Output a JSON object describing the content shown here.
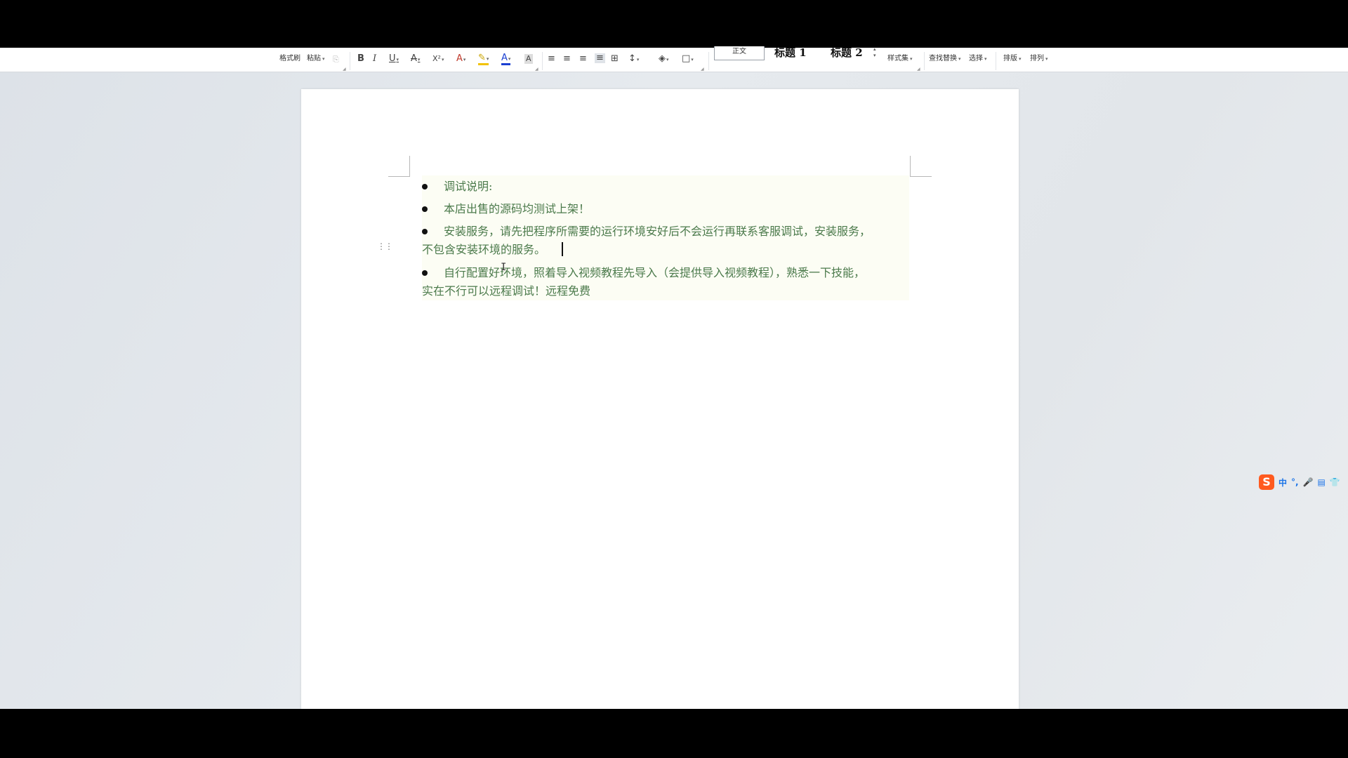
{
  "ribbon": {
    "format_painter": "格式刷",
    "paste": "粘贴",
    "style_normal": "正文",
    "style_heading1": "标题 1",
    "style_heading2": "标题 2",
    "style_set": "样式集",
    "find_replace": "查找替换",
    "select": "选择",
    "layout": "排版",
    "arrange": "排列",
    "icons": {
      "bold": "B",
      "italic": "I",
      "underline": "U",
      "strikethrough": "A",
      "superscript": "X²",
      "text_effect": "A",
      "highlight": "✎",
      "font_color": "A",
      "char_shading": "A",
      "align_left": "≡",
      "align_center": "≡",
      "align_right": "≡",
      "justify": "≡",
      "distributed": "⊞",
      "line_spacing": "↕",
      "shading": "◈",
      "border": "□"
    }
  },
  "document": {
    "lines": [
      "调试说明:",
      "本店出售的源码均测试上架！",
      "安装服务，请先把程序所需要的运行环境安好后不会运行再联系客服调试，安装服务，",
      "不包含安装环境的服务。",
      "自行配置好环境，照着导入视频教程先导入（会提供导入视频教程），熟悉一下技能，",
      "实在不行可以远程调试！远程免费"
    ]
  },
  "ime": {
    "logo": "S",
    "mode": "中",
    "punct": "°,",
    "mic": "🎤",
    "keyboard": "▤",
    "skin": "👕"
  },
  "colors": {
    "text_green": "#4b7a4b",
    "font_color_blue": "#1a3fd1",
    "highlight_yellow": "#f2c200",
    "ime_orange": "#ff5a1f"
  }
}
